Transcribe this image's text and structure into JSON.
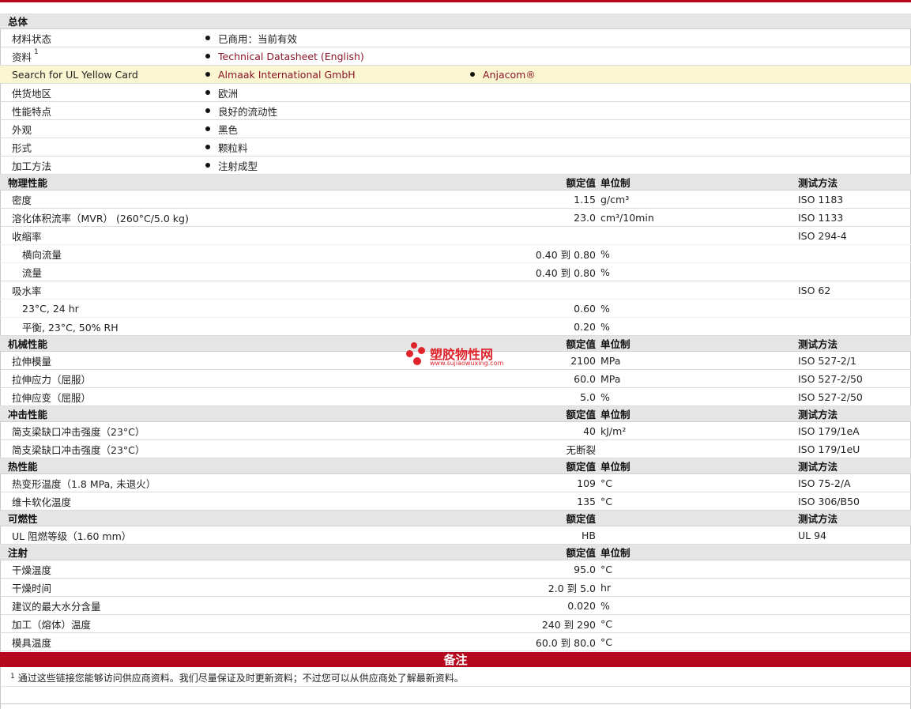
{
  "sections": {
    "general": {
      "title": "总体",
      "rows": [
        {
          "label": "材料状态",
          "items": [
            "已商用：当前有效"
          ]
        },
        {
          "label": "资料",
          "sup": "1",
          "items": [
            "Technical Datasheet (English)"
          ]
        },
        {
          "label": "Search for UL Yellow Card",
          "items": [
            "Almaak International GmbH",
            "Anjacom®"
          ]
        },
        {
          "label": "供货地区",
          "items": [
            "欧洲"
          ]
        },
        {
          "label": "性能特点",
          "items": [
            "良好的流动性"
          ]
        },
        {
          "label": "外观",
          "items": [
            "黑色"
          ]
        },
        {
          "label": "形式",
          "items": [
            "颗粒料"
          ]
        },
        {
          "label": "加工方法",
          "items": [
            "注射成型"
          ]
        }
      ]
    },
    "physical": {
      "title": "物理性能",
      "col_value": "额定值",
      "col_unit": "单位制",
      "col_method": "测试方法",
      "rows": [
        {
          "label": "密度",
          "value": "1.15",
          "unit": "g/cm³",
          "method": "ISO 1183"
        },
        {
          "label": "溶化体积流率（MVR） (260°C/5.0 kg)",
          "value": "23.0",
          "unit": "cm³/10min",
          "method": "ISO 1133"
        },
        {
          "label": "收缩率",
          "value": "",
          "unit": "",
          "method": "ISO 294-4"
        },
        {
          "label": "横向流量",
          "value": "0.40 到  0.80",
          "unit": "%",
          "method": ""
        },
        {
          "label": "流量",
          "value": "0.40 到  0.80",
          "unit": "%",
          "method": ""
        },
        {
          "label": "吸水率",
          "value": "",
          "unit": "",
          "method": "ISO 62"
        },
        {
          "label": "23°C, 24 hr",
          "value": "0.60",
          "unit": "%",
          "method": ""
        },
        {
          "label": "平衡, 23°C, 50% RH",
          "value": "0.20",
          "unit": "%",
          "method": ""
        }
      ]
    },
    "mechanical": {
      "title": "机械性能",
      "col_value": "额定值",
      "col_unit": "单位制",
      "col_method": "测试方法",
      "rows": [
        {
          "label": "拉伸模量",
          "value": "2100",
          "unit": "MPa",
          "method": "ISO 527-2/1"
        },
        {
          "label": "拉伸应力（屈服）",
          "value": "60.0",
          "unit": "MPa",
          "method": "ISO 527-2/50"
        },
        {
          "label": "拉伸应变（屈服）",
          "value": "5.0",
          "unit": "%",
          "method": "ISO 527-2/50"
        }
      ]
    },
    "impact": {
      "title": "冲击性能",
      "col_value": "额定值",
      "col_unit": "单位制",
      "col_method": "测试方法",
      "rows": [
        {
          "label": "简支梁缺口冲击强度（23°C）",
          "value": "40",
          "unit": "kJ/m²",
          "method": "ISO 179/1eA"
        },
        {
          "label": "简支梁缺口冲击强度（23°C）",
          "value": "无断裂",
          "unit": "",
          "method": "ISO 179/1eU"
        }
      ]
    },
    "thermal": {
      "title": "热性能",
      "col_value": "额定值",
      "col_unit": "单位制",
      "col_method": "测试方法",
      "rows": [
        {
          "label": "热变形温度（1.8 MPa, 未退火）",
          "value": "109",
          "unit": "°C",
          "method": "ISO 75-2/A"
        },
        {
          "label": "维卡软化温度",
          "value": "135",
          "unit": "°C",
          "method": "ISO 306/B50"
        }
      ]
    },
    "flammability": {
      "title": "可燃性",
      "col_value": "额定值",
      "col_unit": "",
      "col_method": "测试方法",
      "rows": [
        {
          "label": "UL 阻燃等级（1.60 mm）",
          "value": "HB",
          "unit": "",
          "method": "UL 94"
        }
      ]
    },
    "injection": {
      "title": "注射",
      "col_value": "额定值",
      "col_unit": "单位制",
      "col_method": "",
      "rows": [
        {
          "label": "干燥温度",
          "value": "95.0",
          "unit": "°C",
          "method": ""
        },
        {
          "label": "干燥时间",
          "value": "2.0 到  5.0",
          "unit": "hr",
          "method": ""
        },
        {
          "label": "建议的最大水分含量",
          "value": "0.020",
          "unit": "%",
          "method": ""
        },
        {
          "label": "加工（熔体）温度",
          "value": "240 到  290",
          "unit": "°C",
          "method": ""
        },
        {
          "label": "模具温度",
          "value": "60.0 到  80.0",
          "unit": "°C",
          "method": ""
        }
      ]
    }
  },
  "notes": {
    "title": "备注",
    "footnote_mark": "1",
    "footnote_text": "通过这些链接您能够访问供应商资料。我们尽量保证及时更新资料；不过您可以从供应商处了解最新资料。"
  },
  "watermark": {
    "name": "塑胶物性网",
    "url": "www.sujiaowuxing.com"
  },
  "colors": {
    "accent": "#b5081f",
    "link": "#8a1426",
    "highlight": "#fbf6d2",
    "header_bg": "#e5e5e5"
  }
}
